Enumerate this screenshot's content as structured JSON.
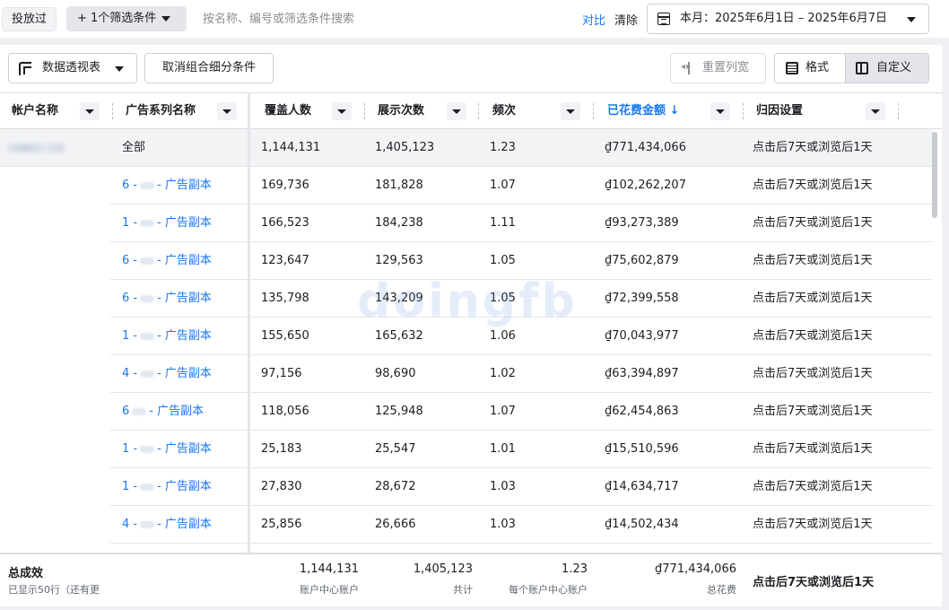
{
  "topbar": {
    "toggle_label": "投放过",
    "filter_label": "+ 1个筛选条件",
    "search_placeholder": "按名称、编号或筛选条件搜索",
    "compare_label": "对比",
    "clear_label": "清除",
    "date_range": "本月：2025年6月1日 – 2025年6月7日"
  },
  "toolbar": {
    "pivot_label": "数据透视表",
    "ungroup_label": "取消组合细分条件",
    "reset_columns_label": "重置列宽",
    "format_label": "格式",
    "custom_label": "自定义"
  },
  "table": {
    "headers": {
      "account": "帐户名称",
      "campaign": "广告系列名称",
      "reach": "覆盖人数",
      "impressions": "展示次数",
      "frequency": "频次",
      "spend": "已花费金额 ↓",
      "attribution": "归因设置"
    },
    "rows": [
      {
        "name": "全部",
        "reach": "1,144,131",
        "impressions": "1,405,123",
        "frequency": "1.23",
        "spend": "₫771,434,066",
        "attribution": "点击后7天或浏览后1天"
      },
      {
        "name_prefix": "6 -",
        "name_suffix": "- 广告副本",
        "reach": "169,736",
        "impressions": "181,828",
        "frequency": "1.07",
        "spend": "₫102,262,207",
        "attribution": "点击后7天或浏览后1天"
      },
      {
        "name_prefix": "1 -",
        "name_suffix": "- 广告副本",
        "reach": "166,523",
        "impressions": "184,238",
        "frequency": "1.11",
        "spend": "₫93,273,389",
        "attribution": "点击后7天或浏览后1天"
      },
      {
        "name_prefix": "6 -",
        "name_suffix": "- 广告副本",
        "reach": "123,647",
        "impressions": "129,563",
        "frequency": "1.05",
        "spend": "₫75,602,879",
        "attribution": "点击后7天或浏览后1天"
      },
      {
        "name_prefix": "6 -",
        "name_suffix": "- 广告副本",
        "reach": "135,798",
        "impressions": "143,209",
        "frequency": "1.05",
        "spend": "₫72,399,558",
        "attribution": "点击后7天或浏览后1天"
      },
      {
        "name_prefix": "1 -",
        "name_suffix": "- 广告副本",
        "reach": "155,650",
        "impressions": "165,632",
        "frequency": "1.06",
        "spend": "₫70,043,977",
        "attribution": "点击后7天或浏览后1天"
      },
      {
        "name_prefix": "4 -",
        "name_suffix": "- 广告副本",
        "reach": "97,156",
        "impressions": "98,690",
        "frequency": "1.02",
        "spend": "₫63,394,897",
        "attribution": "点击后7天或浏览后1天"
      },
      {
        "name_prefix": "6",
        "name_suffix": "- 广告副本",
        "reach": "118,056",
        "impressions": "125,948",
        "frequency": "1.07",
        "spend": "₫62,454,863",
        "attribution": "点击后7天或浏览后1天"
      },
      {
        "name_prefix": "1 -",
        "name_suffix": "- 广告副本",
        "reach": "25,183",
        "impressions": "25,547",
        "frequency": "1.01",
        "spend": "₫15,510,596",
        "attribution": "点击后7天或浏览后1天"
      },
      {
        "name_prefix": "1 -",
        "name_suffix": "- 广告副本",
        "reach": "27,830",
        "impressions": "28,672",
        "frequency": "1.03",
        "spend": "₫14,634,717",
        "attribution": "点击后7天或浏览后1天"
      },
      {
        "name_prefix": "4 -",
        "name_suffix": "- 广告副本",
        "reach": "25,856",
        "impressions": "26,666",
        "frequency": "1.03",
        "spend": "₫14,502,434",
        "attribution": "点击后7天或浏览后1天"
      }
    ]
  },
  "footer": {
    "title": "总成效",
    "subtitle": "已显示50行（还有更",
    "reach": "1,144,131",
    "reach_label": "账户中心账户",
    "impressions": "1,405,123",
    "impressions_label": "共计",
    "frequency": "1.23",
    "frequency_label": "每个账户中心账户",
    "spend": "₫771,434,066",
    "spend_label": "总花费",
    "attribution": "点击后7天或浏览后1天"
  },
  "watermark": "doingfb",
  "colors": {
    "link": "#1877f2",
    "border": "#dadde1",
    "background": "#eef0f3"
  }
}
